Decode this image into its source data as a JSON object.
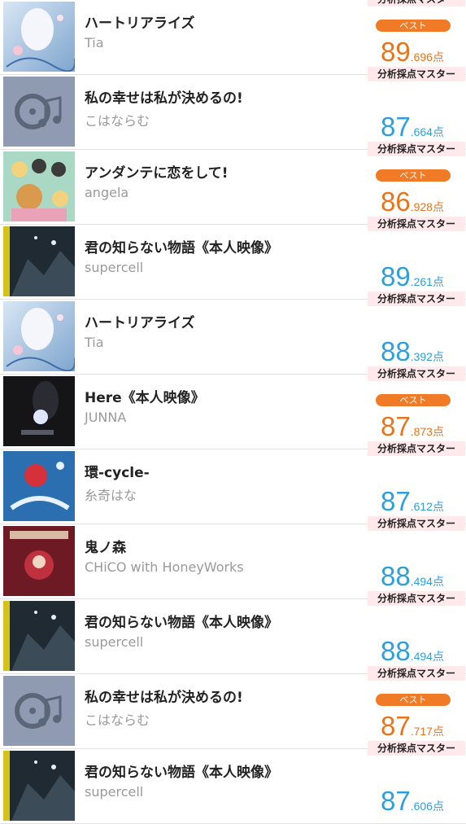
{
  "colors": {
    "score_blue": "#2f9fdc",
    "score_orange": "#e8741c",
    "best_badge_bg": "#f07a26",
    "master_tag_bg": "#ffe9ea"
  },
  "songs": [
    {
      "title": "ハートリアライズ",
      "artist": "Tia",
      "master_label": "分析採点マスター",
      "best": "ベスト",
      "score_int": "89",
      "score_dec": ".696点",
      "score_value": 89.696,
      "is_best": true,
      "art": "hart"
    },
    {
      "title": "私の幸せは私が決めるの!",
      "artist": "こはならむ",
      "master_label": "分析採点マスター",
      "best": "",
      "score_int": "87",
      "score_dec": ".664点",
      "score_value": 87.664,
      "is_best": false,
      "art": "placeholder"
    },
    {
      "title": "アンダンテに恋をして!",
      "artist": "angela",
      "master_label": "分析採点マスター",
      "best": "ベスト",
      "score_int": "86",
      "score_dec": ".928点",
      "score_value": 86.928,
      "is_best": true,
      "art": "anime"
    },
    {
      "title": "君の知らない物語《本人映像》",
      "artist": "supercell",
      "master_label": "分析採点マスター",
      "best": "",
      "score_int": "89",
      "score_dec": ".261点",
      "score_value": 89.261,
      "is_best": false,
      "art": "dark"
    },
    {
      "title": "ハートリアライズ",
      "artist": "Tia",
      "master_label": "分析採点マスター",
      "best": "",
      "score_int": "88",
      "score_dec": ".392点",
      "score_value": 88.392,
      "is_best": false,
      "art": "hart"
    },
    {
      "title": "Here《本人映像》",
      "artist": "JUNNA",
      "master_label": "分析採点マスター",
      "best": "ベスト",
      "score_int": "87",
      "score_dec": ".873点",
      "score_value": 87.873,
      "is_best": true,
      "art": "junna"
    },
    {
      "title": "環-cycle-",
      "artist": "糸奇はな",
      "master_label": "分析採点マスター",
      "best": "",
      "score_int": "87",
      "score_dec": ".612点",
      "score_value": 87.612,
      "is_best": false,
      "art": "cycle"
    },
    {
      "title": "鬼ノ森",
      "artist": "CHiCO with HoneyWorks",
      "master_label": "分析採点マスター",
      "best": "",
      "score_int": "88",
      "score_dec": ".494点",
      "score_value": 88.494,
      "is_best": false,
      "art": "oni"
    },
    {
      "title": "君の知らない物語《本人映像》",
      "artist": "supercell",
      "master_label": "分析採点マスター",
      "best": "",
      "score_int": "88",
      "score_dec": ".494点",
      "score_value": 88.494,
      "is_best": false,
      "art": "dark"
    },
    {
      "title": "私の幸せは私が決めるの!",
      "artist": "こはならむ",
      "master_label": "分析採点マスター",
      "best": "ベスト",
      "score_int": "87",
      "score_dec": ".717点",
      "score_value": 87.717,
      "is_best": true,
      "art": "placeholder"
    },
    {
      "title": "君の知らない物語《本人映像》",
      "artist": "supercell",
      "master_label": "分析採点マスター",
      "best": "",
      "score_int": "87",
      "score_dec": ".606点",
      "score_value": 87.606,
      "is_best": false,
      "art": "dark"
    }
  ]
}
